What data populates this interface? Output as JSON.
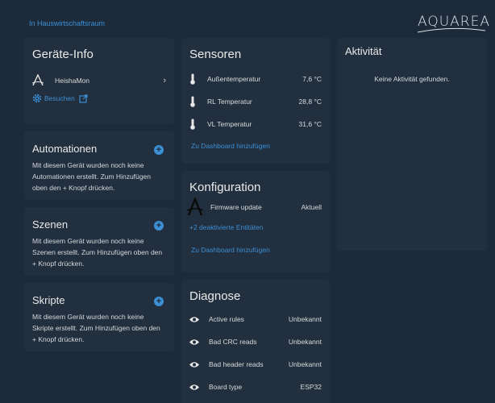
{
  "header": {
    "area_link": "In Hauswirtschaftsraum",
    "logo_text": "AQUAREA"
  },
  "device_info": {
    "title": "Geräte-Info",
    "device_name": "HeishaMon",
    "search_label": "Besuchen"
  },
  "automations": {
    "title": "Automationen",
    "text": "Mit diesem Gerät wurden noch keine Automationen erstellt. Zum Hinzufügen oben den + Knopf drücken."
  },
  "scenes": {
    "title": "Szenen",
    "text": "Mit diesem Gerät wurden noch keine Szenen erstellt. Zum Hinzufügen oben den + Knopf drücken."
  },
  "scripts": {
    "title": "Skripte",
    "text": "Mit diesem Gerät wurden noch keine Skripte erstellt. Zum Hinzufügen oben den + Knopf drücken."
  },
  "sensors": {
    "title": "Sensoren",
    "rows": [
      {
        "name": "Außentemperatur",
        "value": "7,6 °C"
      },
      {
        "name": "RL Temperatur",
        "value": "28,8 °C"
      },
      {
        "name": "VL Temperatur",
        "value": "31,6 °C"
      }
    ],
    "add_to_dashboard": "Zu Dashboard hinzufügen"
  },
  "configuration": {
    "title": "Konfiguration",
    "firmware_label": "Firmware update",
    "firmware_value": "Aktuell",
    "disabled_entities": "+2 deaktivierte Entitäten",
    "add_to_dashboard": "Zu Dashboard hinzufügen"
  },
  "diagnostics": {
    "title": "Diagnose",
    "rows": [
      {
        "name": "Active rules",
        "value": "Unbekannt"
      },
      {
        "name": "Bad CRC reads",
        "value": "Unbekannt"
      },
      {
        "name": "Bad header reads",
        "value": "Unbekannt"
      },
      {
        "name": "Board type",
        "value": "ESP32"
      }
    ]
  },
  "activity": {
    "title": "Aktivität",
    "empty": "Keine Aktivität gefunden."
  },
  "colors": {
    "background": "#1c2a3a",
    "card": "#212f3f",
    "accent": "#3b8fd4",
    "text": "#e1e1e1"
  }
}
